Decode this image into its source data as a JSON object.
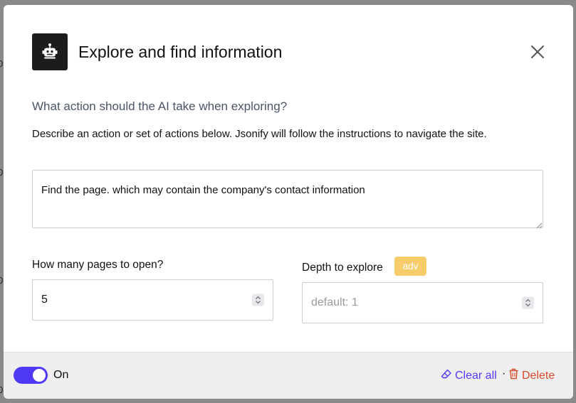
{
  "header": {
    "title": "Explore and find information"
  },
  "main": {
    "question": "What action should the AI take when exploring?",
    "description": "Describe an action or set of actions below. Jsonify will follow the instructions to navigate the site.",
    "instructions_value": "Find the page. which may contain the company's contact information",
    "pages": {
      "label": "How many pages to open?",
      "value": "5"
    },
    "depth": {
      "label": "Depth to explore",
      "badge": "adv",
      "placeholder": "default: 1"
    }
  },
  "footer": {
    "toggle_label": "On",
    "toggle_on": true,
    "clear_label": "Clear all",
    "separator": "·",
    "delete_label": "Delete"
  },
  "colors": {
    "accent": "#4f39f6",
    "danger": "#d94a2b",
    "badge": "#f7cc6b"
  },
  "icons": [
    "robot-icon",
    "close-icon",
    "spinner-icon",
    "eraser-icon",
    "trash-icon"
  ]
}
